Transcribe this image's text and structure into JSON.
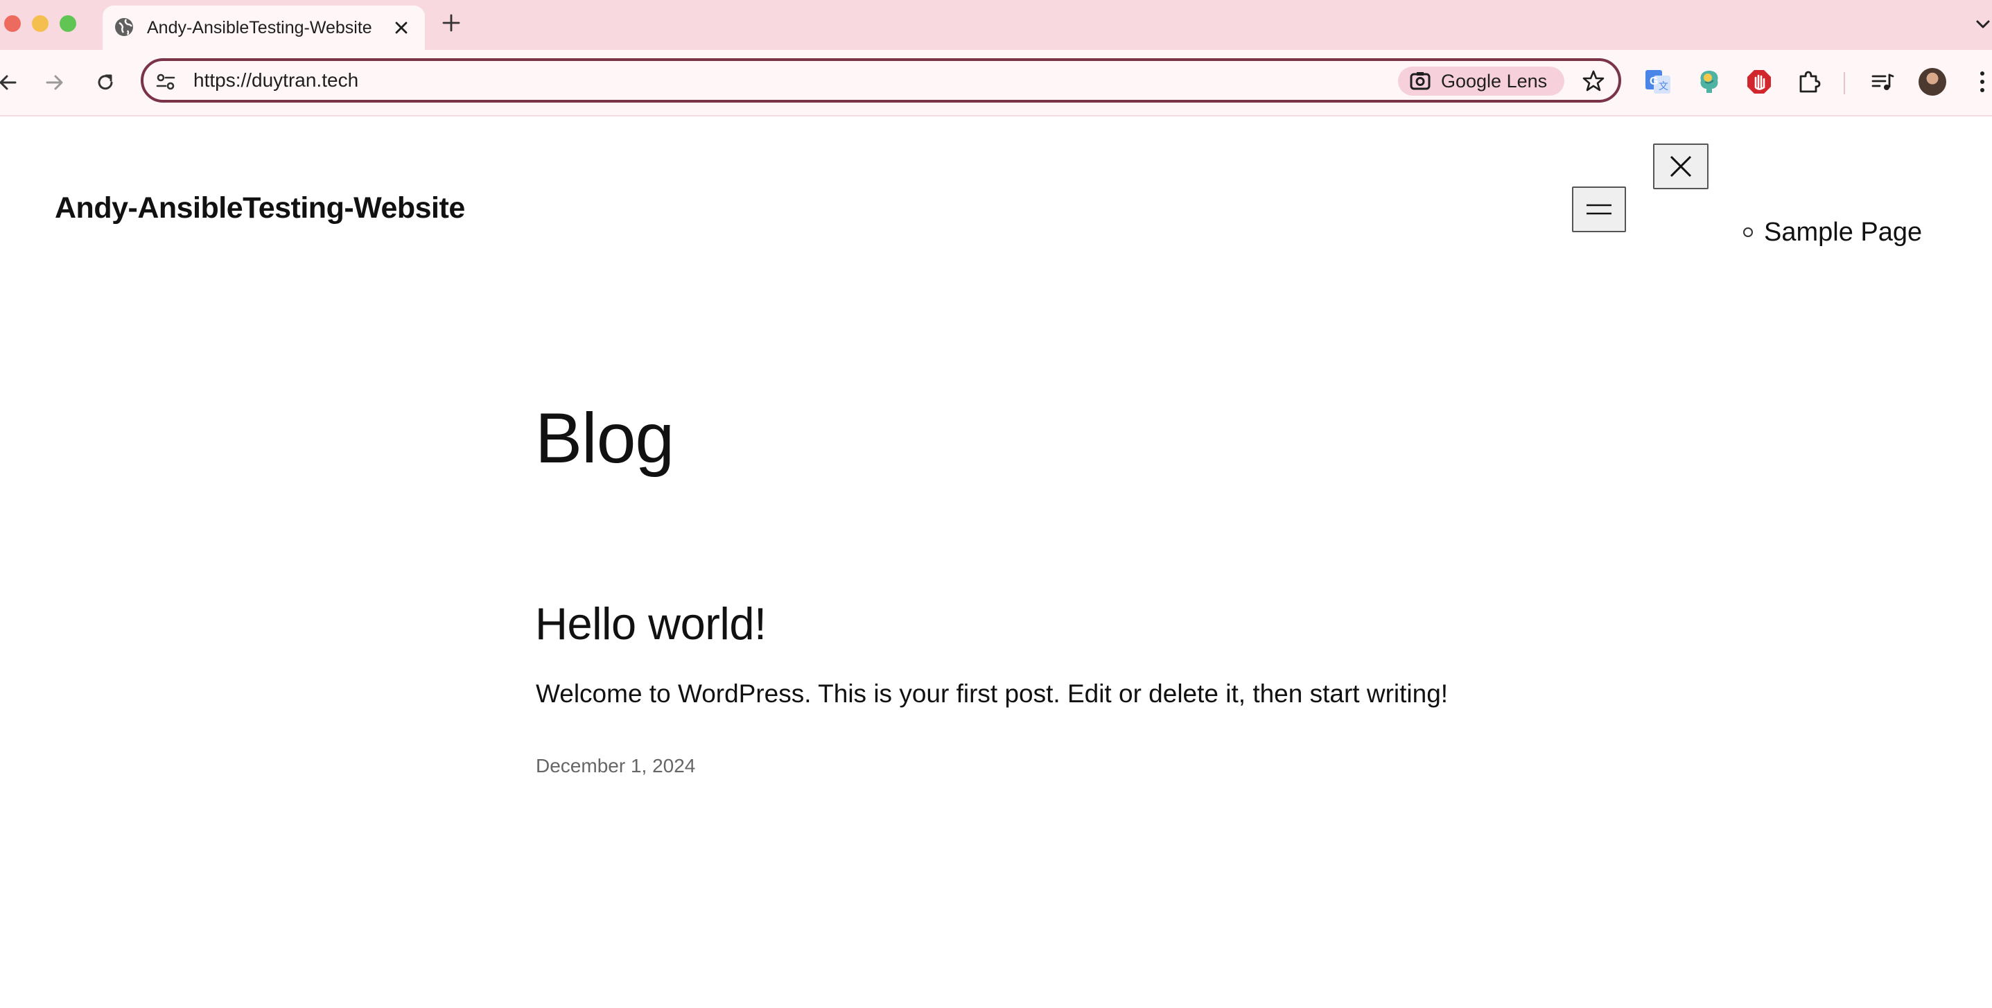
{
  "browser": {
    "tab": {
      "title": "Andy-AnsibleTesting-Website",
      "favicon": "globe-icon"
    },
    "address_bar": {
      "url": "https://duytran.tech"
    },
    "lens_chip": {
      "label": "Google Lens"
    },
    "accent_color": "#7a3448",
    "tabbar_color": "#f8d9e0",
    "extensions": [
      "google-translate-icon",
      "brain-extension-icon",
      "stop-hand-extension-icon",
      "puzzle-extensions-icon",
      "media-control-icon"
    ]
  },
  "site": {
    "title": "Andy-AnsibleTesting-Website",
    "nav": {
      "items": [
        {
          "label": "Sample Page"
        }
      ]
    }
  },
  "main": {
    "heading": "Blog",
    "posts": [
      {
        "title": "Hello world!",
        "excerpt": "Welcome to WordPress. This is your first post. Edit or delete it, then start writing!",
        "date": "December 1, 2024"
      }
    ]
  }
}
